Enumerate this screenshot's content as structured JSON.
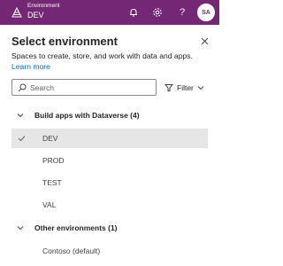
{
  "header": {
    "env_label": "Environment",
    "env_name": "DEV",
    "help_glyph": "?",
    "avatar_initials": "SA",
    "brand_color": "#742774",
    "icons": [
      "environment-icon",
      "bell-icon",
      "gear-icon",
      "help-icon"
    ]
  },
  "panel": {
    "title": "Select environment",
    "description": "Spaces to create, store, and work with data and apps.",
    "learn_more": "Learn more",
    "search_placeholder": "Search",
    "filter_label": "Filter"
  },
  "groups": [
    {
      "label": "Build apps with Dataverse (4)",
      "items": [
        {
          "label": "DEV",
          "selected": true
        },
        {
          "label": "PROD",
          "selected": false
        },
        {
          "label": "TEST",
          "selected": false
        },
        {
          "label": "VAL",
          "selected": false
        }
      ]
    },
    {
      "label": "Other environments (1)",
      "items": [
        {
          "label": "Contoso (default)",
          "selected": false
        }
      ]
    }
  ],
  "colors": {
    "link": "#0f6cbd",
    "selected_row": "#e6e6e6"
  }
}
